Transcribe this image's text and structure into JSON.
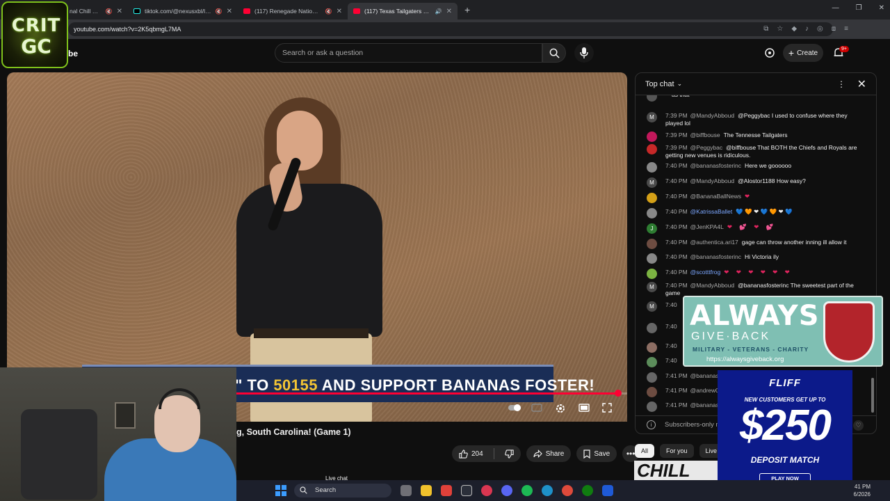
{
  "browser": {
    "tabs": [
      {
        "title": "nal Chill Ses"
      },
      {
        "title": "tiktok.com/@nexusxbl/live"
      },
      {
        "title": "(117) Renegade Nation_wi"
      },
      {
        "title": "(117) Texas Tailgaters vs Ind"
      }
    ],
    "url": "youtube.com/watch?v=2K5qbmgL7MA"
  },
  "youtube": {
    "logo_fragment": "be",
    "search_placeholder": "Search or ask a question",
    "create_label": "Create",
    "notif_count": "9+"
  },
  "video": {
    "banner_pre": "\" TO ",
    "banner_hl": "50155",
    "banner_post": " AND SUPPORT BANANAS FOSTER!",
    "progress": 0.985,
    "title": "g, South Carolina! (Game 1)"
  },
  "actions": {
    "likes": "204",
    "share": "Share",
    "save": "Save",
    "live_chat": "Live chat"
  },
  "chat": {
    "header": "Top chat",
    "messages": [
      {
        "initial": "",
        "time": "",
        "author": "",
        "text": "as that",
        "kind": "text"
      },
      {
        "initial": "M",
        "time": "7:39 PM",
        "author": "@MandyAbboud",
        "text": "@Peggybac I used to confuse where they played lol",
        "kind": "text"
      },
      {
        "initial": "",
        "time": "7:39 PM",
        "author": "@biffbouse",
        "text": "The Tennesse Tailgaters",
        "kind": "text"
      },
      {
        "initial": "",
        "time": "7:39 PM",
        "author": "@Peggybac",
        "text": "@biffbouse That BOTH the Chiefs and Royals are getting new venues is ridiculous.",
        "kind": "text"
      },
      {
        "initial": "",
        "time": "7:40 PM",
        "author": "@bananasfosterinc",
        "text": "Here we goooooo",
        "kind": "text"
      },
      {
        "initial": "M",
        "time": "7:40 PM",
        "author": "@MandyAbboud",
        "text": "@Alostor1188 How easy?",
        "kind": "text"
      },
      {
        "initial": "",
        "time": "7:40 PM",
        "author": "@BananaBallNews",
        "text": "❤",
        "kind": "hearts"
      },
      {
        "initial": "",
        "time": "7:40 PM",
        "author": "@KatrissaBallet",
        "text": "💙 🧡 ❤ 💙 🧡 ❤ 💙",
        "kind": "mixed"
      },
      {
        "initial": "J",
        "time": "7:40 PM",
        "author": "@JenKPA4L",
        "text": "❤ 💕 ❤ 💕",
        "kind": "hearts"
      },
      {
        "initial": "",
        "time": "7:40 PM",
        "author": "@authentica.ari17",
        "text": "gage can throw another inning ill allow it",
        "kind": "text"
      },
      {
        "initial": "",
        "time": "7:40 PM",
        "author": "@bananasfosterinc",
        "text": "Hi Victoria ily",
        "kind": "text"
      },
      {
        "initial": "",
        "time": "7:40 PM",
        "author": "@scotttfrog",
        "text": "❤ ❤ ❤ ❤ ❤ ❤",
        "kind": "hearts"
      },
      {
        "initial": "M",
        "time": "7:40 PM",
        "author": "@MandyAbboud",
        "text": "@bananasfosterinc The sweetest part of the game",
        "kind": "text"
      },
      {
        "initial": "M",
        "time": "7:40",
        "author": "",
        "text": "",
        "kind": "text"
      },
      {
        "initial": "",
        "time": "7:40",
        "author": "",
        "text": "",
        "kind": "text"
      },
      {
        "initial": "",
        "time": "7:40",
        "author": "",
        "text": "",
        "kind": "text"
      },
      {
        "initial": "",
        "time": "7:40",
        "author": "",
        "text": "",
        "kind": "text"
      },
      {
        "initial": "",
        "time": "7:41 PM",
        "author": "@bananasf",
        "text": "",
        "kind": "text"
      },
      {
        "initial": "",
        "time": "7:41 PM",
        "author": "@andrew06",
        "text": "",
        "kind": "text"
      },
      {
        "initial": "",
        "time": "7:41 PM",
        "author": "@bananasf",
        "text": "",
        "kind": "text"
      }
    ],
    "footer": "Subscribers-only m"
  },
  "chips": [
    "All",
    "For you",
    "Live"
  ],
  "overlays": {
    "crit_line1": "CRIT",
    "crit_line2": "GC",
    "agb_always": "ALWAYS",
    "agb_giveback": "GIVE·BACK",
    "agb_sub": "MILITARY - VETERANS - CHARITY",
    "agb_url": "https://alwaysgiveback.org",
    "fliff_logo": "FLIFF",
    "fliff_sub": "NEW CUSTOMERS GET UP TO",
    "fliff_amount": "$250",
    "fliff_deposit": "DEPOSIT MATCH",
    "fliff_cta": "PLAY NOW",
    "chill": "CHILL"
  },
  "taskbar": {
    "search_label": "Search",
    "time": "41 PM",
    "date": "6/2026"
  },
  "colors": {
    "accent": "#ff0033",
    "chat_bg": "#0f0f0f",
    "taskbar": "#1c1f2b"
  }
}
